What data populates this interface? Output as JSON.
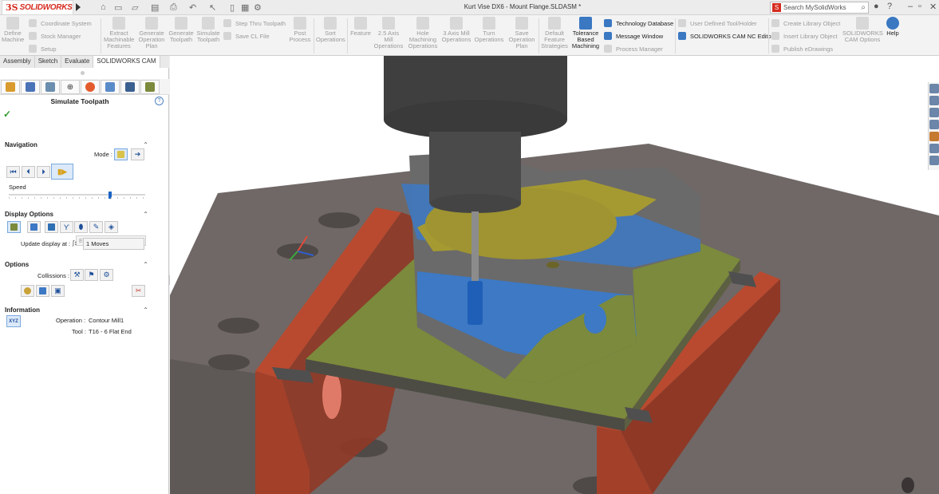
{
  "app": {
    "brand_ds": "3S",
    "brand_name": "SOLIDWORKS"
  },
  "document_title": "Kurt Vise DX6 - Mount Flange.SLDASM *",
  "search": {
    "placeholder": "Search MySolidWorks"
  },
  "title_icons": [
    "home-icon",
    "new-icon",
    "open-icon",
    "save-icon",
    "print-icon",
    "undo-icon",
    "select-icon",
    "rebuild-icon",
    "options-icon"
  ],
  "command_manager": {
    "define_machine": "Define\nMachine",
    "coordinate_system": "Coordinate System",
    "stock_manager": "Stock Manager",
    "setup": "Setup",
    "extract_features": "Extract\nMachinable\nFeatures",
    "generate_plan": "Generate\nOperation\nPlan",
    "generate_toolpath": "Generate\nToolpath",
    "simulate_toolpath": "Simulate\nToolpath",
    "step_thru": "Step Thru Toolpath",
    "save_cl": "Save CL File",
    "post_process": "Post\nProcess",
    "sort_operations": "Sort\nOperations",
    "feature": "Feature",
    "mill_25": "2.5 Axis\nMill\nOperations",
    "hole_machining": "Hole\nMachining\nOperations",
    "mill_3": "3 Axis Mill\nOperations",
    "turn_operations": "Turn\nOperations",
    "save_plan": "Save\nOperation\nPlan",
    "default_strategies": "Default\nFeature\nStrategies",
    "tolerance": "Tolerance\nBased\nMachining",
    "technology_database": "Technology Database",
    "message_window": "Message Window",
    "process_manager": "Process Manager",
    "user_tool": "User Defined Tool/Holder",
    "nc_editor": "SOLIDWORKS CAM NC Editor",
    "create_library": "Create Library Object",
    "insert_library": "Insert Library Object",
    "publish_edrawings": "Publish eDrawings",
    "cam_options": "SOLIDWORKS\nCAM Options",
    "help": "Help"
  },
  "tabs": [
    {
      "label": "Assembly",
      "active": false
    },
    {
      "label": "Sketch",
      "active": false
    },
    {
      "label": "Evaluate",
      "active": false
    },
    {
      "label": "SOLIDWORKS CAM",
      "active": true
    }
  ],
  "panel": {
    "title": "Simulate Toolpath",
    "help": "?",
    "ok": "✓",
    "navigation": {
      "heading": "Navigation",
      "mode_label": "Mode :",
      "end_option": "End",
      "speed_label": "Speed",
      "speed_fraction": 0.74
    },
    "display_options": {
      "heading": "Display Options",
      "update_label": "Update display at :",
      "update_value": "1 Moves"
    },
    "options": {
      "heading": "Options",
      "collisions_label": "Collissions :"
    },
    "information": {
      "heading": "Information",
      "xyz": "XYZ",
      "operation_label": "Operation :",
      "operation_value": "Contour Mill1",
      "tool_label": "Tool :",
      "tool_value": "T16 - 6 Flat End"
    }
  },
  "colors": {
    "accent": "#1c64c6",
    "brand": "#d52b1e",
    "vise_red": "#b94a2f",
    "stock_green": "#7b8a3c",
    "cut_blue": "#3d79c4",
    "part_gray": "#6a6a6a",
    "floor_gray": "#6f6866"
  }
}
